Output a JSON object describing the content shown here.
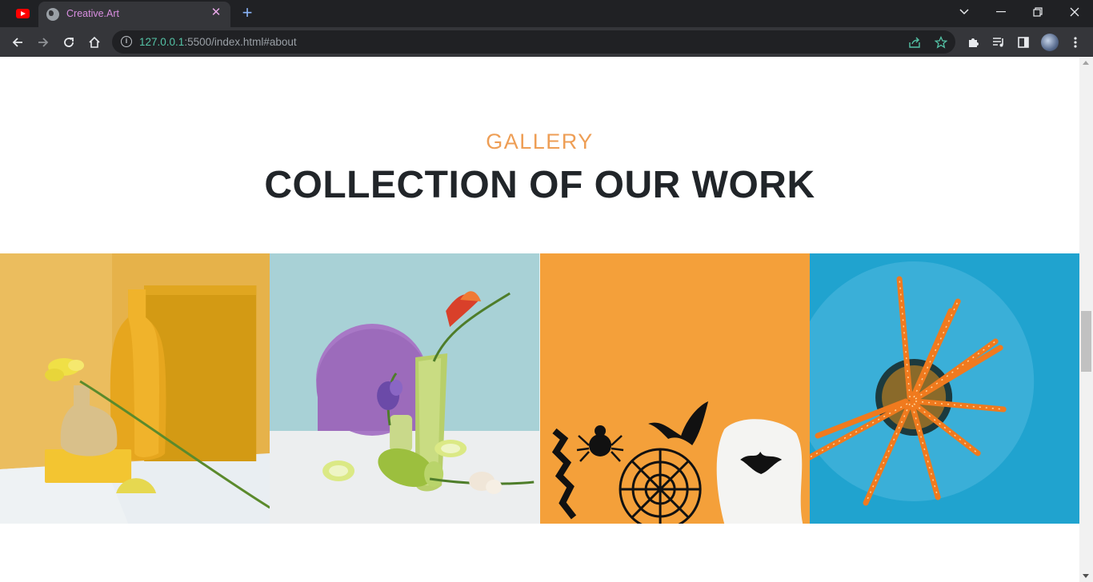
{
  "browser": {
    "tab_title": "Creative.Art",
    "url_host": "127.0.0.1",
    "url_rest": ":5500/index.html#about"
  },
  "gallery": {
    "eyebrow": "GALLERY",
    "heading": "COLLECTION OF OUR WORK",
    "items": [
      {
        "name": "yellow-vases-still-life",
        "bg": "#e9b74b"
      },
      {
        "name": "lilac-disc-freesia-still-life",
        "bg": "#a9d2d6"
      },
      {
        "name": "halloween-paper-cutouts",
        "bg": "#f4a13c"
      },
      {
        "name": "orange-straws-in-cup",
        "bg": "#1fa5d0"
      }
    ]
  },
  "colors": {
    "accent": "#ee9e55",
    "heading": "#212529",
    "chrome_dark": "#202124",
    "chrome_toolbar": "#35363a"
  }
}
